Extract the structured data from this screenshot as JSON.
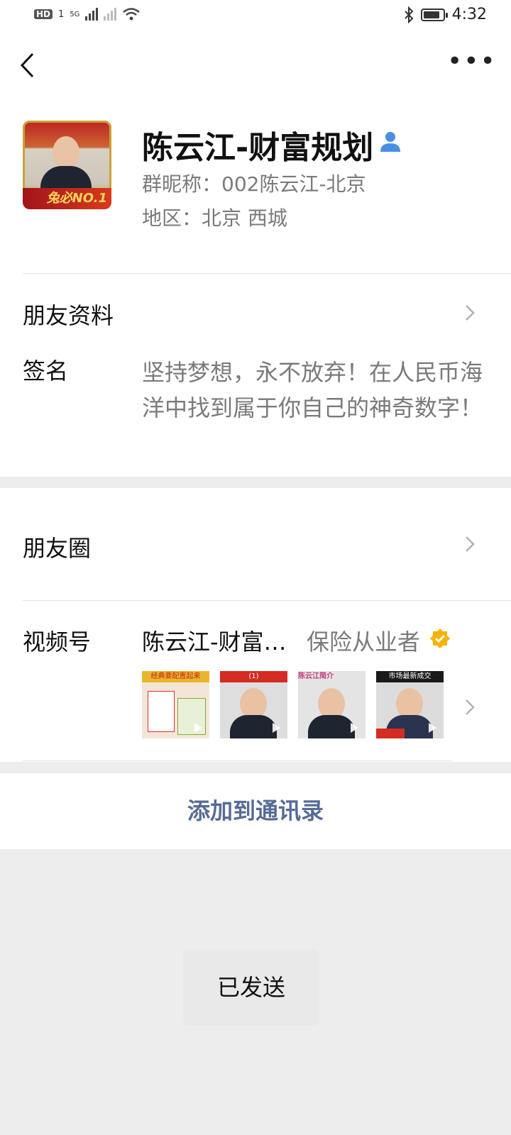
{
  "status_bar": {
    "hd_label": "HD",
    "sim_label": "1",
    "network_label": "5G",
    "time": "4:32",
    "icons": [
      "signal-icon",
      "wifi-icon",
      "bluetooth-icon",
      "battery-icon"
    ]
  },
  "nav": {
    "back_icon": "chevron-left-icon",
    "more_label": "•••"
  },
  "profile": {
    "name": "陈云江-财富规划",
    "group_nickname": "群昵称：002陈云江-北京",
    "region": "地区：北京  西城",
    "avatar_badge": "兔必NO.1"
  },
  "rows": {
    "friend_info_label": "朋友资料",
    "signature_label": "签名",
    "signature_text": "坚持梦想，永不放弃！在人民币海洋中找到属于你自己的神奇数字！",
    "moments_label": "朋友圈",
    "channels_label": "视频号",
    "channels_name": "陈云江-财富…",
    "channels_role": "保险从业者",
    "thumbnails": [
      {
        "caption": "经典要配置起来",
        "color": "#e8b62e"
      },
      {
        "caption": "(1)",
        "color": "#d42b22"
      },
      {
        "caption": "陈云江简介",
        "color": "#c43a7a"
      },
      {
        "caption": "市场最新成交",
        "color": "#1a1a1a"
      }
    ]
  },
  "actions": {
    "add_contact": "添加到通讯录",
    "sent_toast": "已发送"
  },
  "colors": {
    "link_blue": "#576b95",
    "verify_gold": "#f5b400",
    "background": "#ededed"
  }
}
